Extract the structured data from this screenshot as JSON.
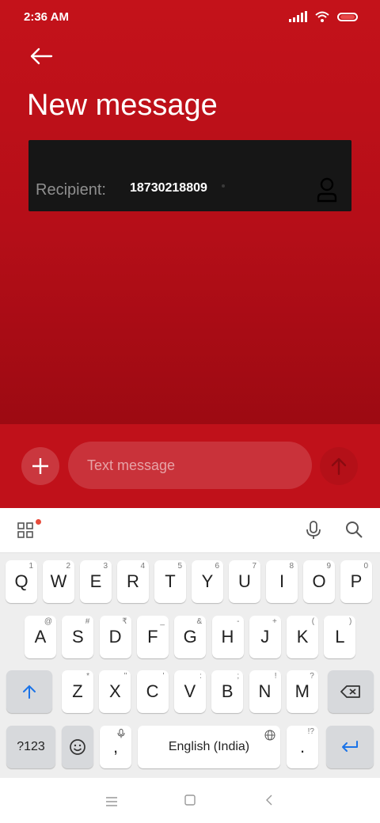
{
  "status_bar": {
    "time": "2:36 AM"
  },
  "header": {
    "title": "New message"
  },
  "recipient": {
    "label": "Recipient:",
    "value": "18730218809"
  },
  "composer": {
    "placeholder": "Text message"
  },
  "keyboard": {
    "row1": [
      {
        "label": "Q",
        "hint": "1"
      },
      {
        "label": "W",
        "hint": "2"
      },
      {
        "label": "E",
        "hint": "3"
      },
      {
        "label": "R",
        "hint": "4"
      },
      {
        "label": "T",
        "hint": "5"
      },
      {
        "label": "Y",
        "hint": "6"
      },
      {
        "label": "U",
        "hint": "7"
      },
      {
        "label": "I",
        "hint": "8"
      },
      {
        "label": "O",
        "hint": "9"
      },
      {
        "label": "P",
        "hint": "0"
      }
    ],
    "row2": [
      {
        "label": "A",
        "hint": "@"
      },
      {
        "label": "S",
        "hint": "#"
      },
      {
        "label": "D",
        "hint": "₹"
      },
      {
        "label": "F",
        "hint": "_"
      },
      {
        "label": "G",
        "hint": "&"
      },
      {
        "label": "H",
        "hint": "-"
      },
      {
        "label": "J",
        "hint": "+"
      },
      {
        "label": "K",
        "hint": "("
      },
      {
        "label": "L",
        "hint": ")"
      }
    ],
    "row3": [
      {
        "label": "Z",
        "hint": "*"
      },
      {
        "label": "X",
        "hint": "\""
      },
      {
        "label": "C",
        "hint": "'"
      },
      {
        "label": "V",
        "hint": ":"
      },
      {
        "label": "B",
        "hint": ";"
      },
      {
        "label": "N",
        "hint": "!"
      },
      {
        "label": "M",
        "hint": "?"
      }
    ],
    "symbols_label": "?123",
    "comma_label": ",",
    "space_label": "English (India)",
    "period_label": ".",
    "period_hint": "!?"
  }
}
